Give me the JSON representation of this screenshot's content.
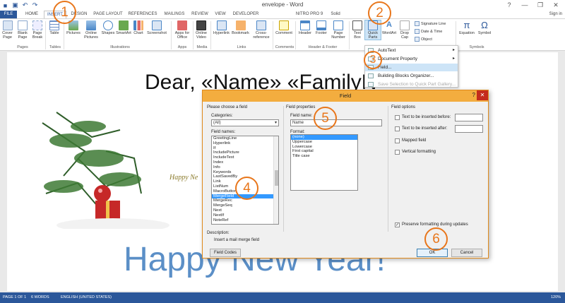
{
  "window": {
    "title": "envelope - Word",
    "help": "?",
    "minimize": "—",
    "restore": "❐",
    "close": "✕"
  },
  "tabs": [
    "FILE",
    "HOME",
    "INSERT",
    "DESIGN",
    "PAGE LAYOUT",
    "REFERENCES",
    "MAILINGS",
    "REVIEW",
    "VIEW",
    "DEVELOPER",
    "NITRO PRO 9",
    "Solid"
  ],
  "signin": "Sign in",
  "ribbon": {
    "buttons": [
      "Cover Page",
      "Blank Page",
      "Page Break",
      "Table",
      "Pictures",
      "Online Pictures",
      "Shapes",
      "SmartArt",
      "Chart",
      "Screenshot",
      "Apps for Office",
      "Online Video",
      "Hyperlink",
      "Bookmark",
      "Cross-reference",
      "Comment",
      "Header",
      "Footer",
      "Page Number",
      "Text Box",
      "Quick Parts",
      "WordArt",
      "Drop Cap",
      "Equation",
      "Symbol"
    ],
    "side_buttons": [
      "Signature Line",
      "Date & Time",
      "Object"
    ],
    "groups": [
      "Pages",
      "Tables",
      "Illustrations",
      "Apps",
      "Media",
      "Links",
      "Comments",
      "Header & Footer",
      "Symbols"
    ]
  },
  "quick_parts_menu": [
    "AutoText",
    "Document Property",
    "Field...",
    "Building Blocks Organizer...",
    "Save Selection to Quick Part Gallery..."
  ],
  "document": {
    "greeting": "Dear, «Name» «FamilyN",
    "card_text": "Happy Ne",
    "footer_text": "Happy New Year!"
  },
  "dialog": {
    "title": "Field",
    "choose_header": "Please choose a field",
    "categories_label": "Categories:",
    "categories_value": "(All)",
    "field_names_label": "Field names:",
    "field_names": [
      "GreetingLine",
      "Hyperlink",
      "If",
      "IncludePicture",
      "IncludeText",
      "Index",
      "Info",
      "Keywords",
      "LastSavedBy",
      "Link",
      "ListNum",
      "MacroButton",
      "MergeField",
      "MergeRec",
      "MergeSeq",
      "Next",
      "NextIf",
      "NoteRef"
    ],
    "selected_field": "MergeField",
    "properties_header": "Field properties",
    "field_name_label": "Field name:",
    "field_name_value": "Name",
    "format_label": "Format:",
    "formats": [
      "(none)",
      "Uppercase",
      "Lowercase",
      "First capital",
      "Title case"
    ],
    "options_header": "Field options",
    "options": [
      "Text to be inserted before:",
      "Text to be inserted after:",
      "Mapped field",
      "Vertical formatting"
    ],
    "preserve_label": "Preserve formatting during updates",
    "preserve_checked": "✓",
    "description_label": "Description:",
    "description_text": "Insert a mail merge field",
    "field_codes_button": "Field Codes",
    "ok_button": "OK",
    "cancel_button": "Cancel"
  },
  "status": {
    "page": "PAGE 1 OF 1",
    "words": "6 WORDS",
    "language": "ENGLISH (UNITED STATES)",
    "zoom": "120%"
  },
  "callouts": [
    "1",
    "2",
    "3",
    "4",
    "5",
    "6"
  ],
  "colors": {
    "accent": "#2b579a",
    "callout": "#e8761b",
    "dialog_title": "#f3ad3f",
    "selection": "#3399ff"
  }
}
